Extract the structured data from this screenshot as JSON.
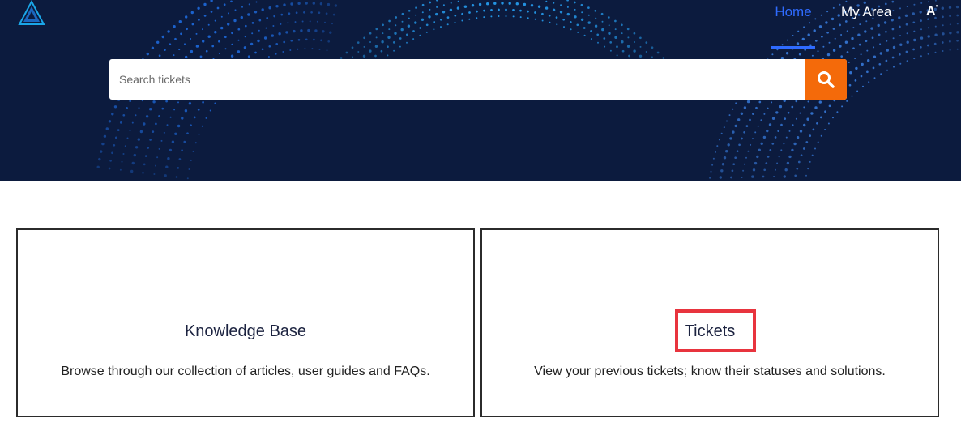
{
  "header": {
    "logo_icon": "logo-triangle-icon",
    "nav": {
      "home_label": "Home",
      "my_area_label": "My Area",
      "accessibility_label": "A"
    },
    "colors": {
      "background": "#0c1b3e",
      "active_nav": "#2f6bff",
      "search_button": "#f46a0a"
    }
  },
  "search": {
    "placeholder": "Search tickets",
    "value": "",
    "button_icon": "search-icon"
  },
  "cards": [
    {
      "title": "Knowledge Base",
      "description": "Browse through our collection of articles, user guides and FAQs."
    },
    {
      "title": "Tickets",
      "description": "View your previous tickets; know their statuses and solutions.",
      "highlighted": true,
      "highlight_color": "#e8343e"
    }
  ]
}
